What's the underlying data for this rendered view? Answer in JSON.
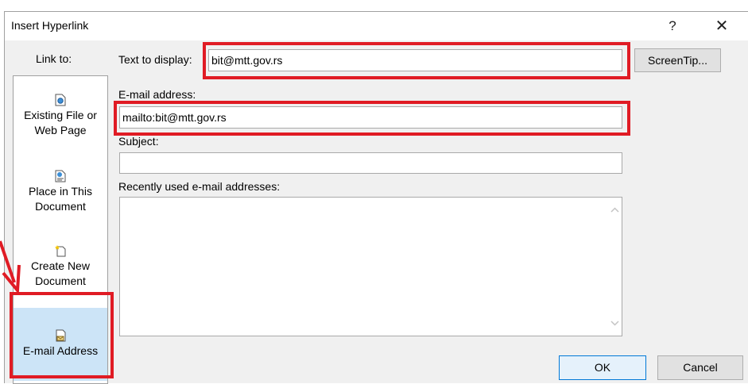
{
  "window": {
    "title": "Insert Hyperlink",
    "help_glyph": "?",
    "close_glyph": "✕"
  },
  "link_to": {
    "heading": "Link to:",
    "items": [
      {
        "line1": "Existing File or",
        "line2": "Web Page",
        "icon": "file-web-icon"
      },
      {
        "line1": "Place in This",
        "line2": "Document",
        "icon": "place-in-document-icon"
      },
      {
        "line1": "Create New",
        "line2": "Document",
        "icon": "new-document-icon"
      },
      {
        "line1": "E-mail Address",
        "line2": "",
        "icon": "email-address-icon",
        "selected": true
      }
    ]
  },
  "fields": {
    "text_to_display_label": "Text to display:",
    "text_to_display_value": "bit@mtt.gov.rs",
    "email_label": "E-mail address:",
    "email_value": "mailto:bit@mtt.gov.rs",
    "subject_label": "Subject:",
    "subject_value": "",
    "recent_label": "Recently used e-mail addresses:"
  },
  "buttons": {
    "screentip": "ScreenTip...",
    "ok": "OK",
    "cancel": "Cancel"
  },
  "colors": {
    "highlight": "#e01b24",
    "selected_bg": "#cce4f7"
  }
}
